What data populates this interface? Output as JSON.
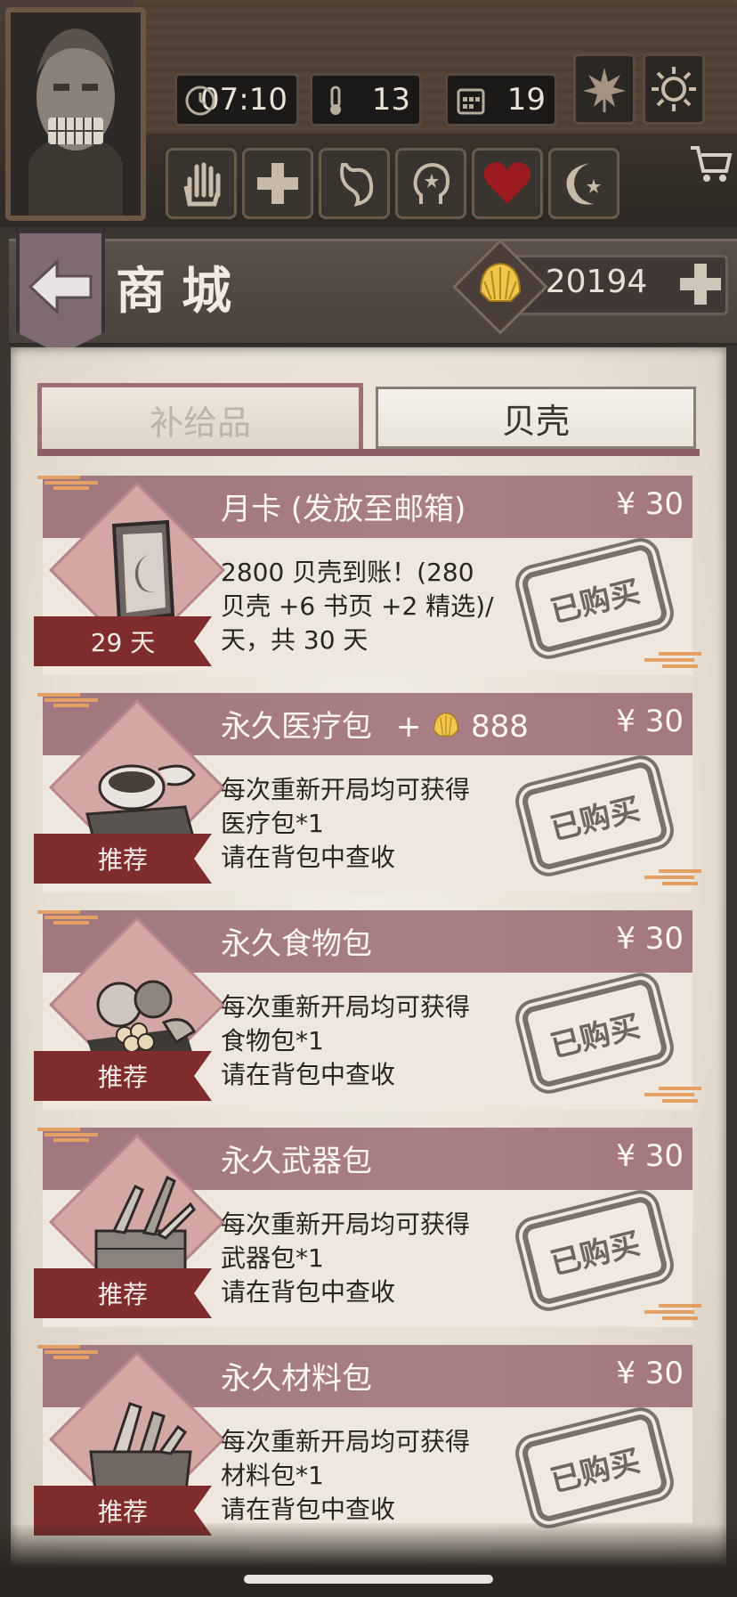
{
  "hud": {
    "time": "07:10",
    "temperature": "13",
    "day": "19",
    "weather_icons": [
      "leaf-icon",
      "sun-icon"
    ],
    "action_icons": [
      "hand-icon",
      "medical-cross-icon",
      "stomach-icon",
      "head-icon",
      "heart-icon",
      "moon-icon"
    ]
  },
  "header": {
    "title": "商城",
    "shell_balance": "20194"
  },
  "tabs": [
    {
      "label": "补给品",
      "active": true
    },
    {
      "label": "贝壳",
      "active": false
    }
  ],
  "products": [
    {
      "name": "月卡 (发放至邮箱)",
      "price": "¥ 30",
      "desc": "2800 贝壳到账！(280\n贝壳 +6 书页 +2 精选)/\n天，共 30 天",
      "ribbon": "29 天",
      "status": "已购买",
      "icon": "moon-card-icon"
    },
    {
      "name": "永久医疗包",
      "bonus_prefix": "+",
      "bonus_value": "888",
      "price": "¥ 30",
      "desc": "每次重新开局均可获得\n医疗包*1\n请在背包中查收",
      "ribbon": "推荐",
      "status": "已购买",
      "icon": "medical-pack-icon"
    },
    {
      "name": "永久食物包",
      "price": "¥ 30",
      "desc": "每次重新开局均可获得\n食物包*1\n请在背包中查收",
      "ribbon": "推荐",
      "status": "已购买",
      "icon": "food-pack-icon"
    },
    {
      "name": "永久武器包",
      "price": "¥ 30",
      "desc": "每次重新开局均可获得\n武器包*1\n请在背包中查收",
      "ribbon": "推荐",
      "status": "已购买",
      "icon": "weapon-pack-icon"
    },
    {
      "name": "永久材料包",
      "price": "¥ 30",
      "desc": "每次重新开局均可获得\n材料包*1\n请在背包中查收",
      "ribbon": "推荐",
      "status": "已购买",
      "icon": "material-pack-icon"
    }
  ],
  "colors": {
    "band": "#a0777c",
    "ribbon": "#7f2c2f",
    "tab_accent": "#8f5f67",
    "paper": "#ece6dc"
  }
}
